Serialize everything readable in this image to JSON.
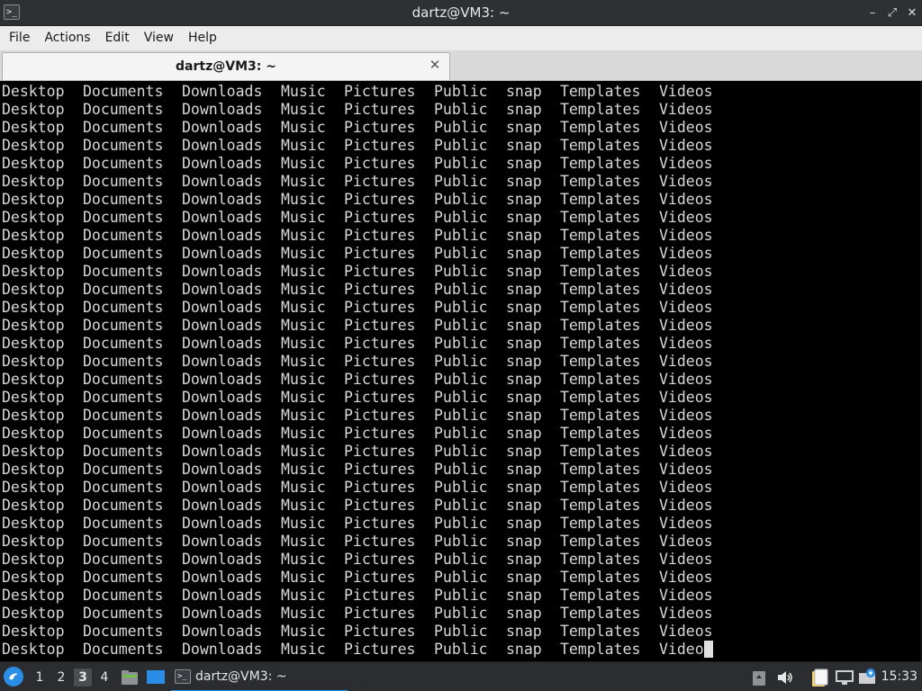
{
  "window": {
    "title": "dartz@VM3: ~",
    "app_icon_glyph": ">_",
    "controls": {
      "minimize": "–",
      "maximize": "⤢",
      "close": "✕"
    }
  },
  "menu": [
    "File",
    "Actions",
    "Edit",
    "View",
    "Help"
  ],
  "tabs": [
    {
      "label": "dartz@VM3: ~",
      "close_glyph": "✕"
    }
  ],
  "terminal": {
    "columns": [
      "Desktop",
      "Documents",
      "Downloads",
      "Music",
      "Pictures",
      "Public",
      "snap",
      "Templates",
      "Videos"
    ],
    "last_line_columns": [
      "Desktop",
      "Documents",
      "Downloads",
      "Music",
      "Pictures",
      "Public",
      "snap",
      "Templates",
      "Video"
    ],
    "repeated_line_count": 31,
    "foreground": "#d8d8d8",
    "background": "#000000"
  },
  "taskbar": {
    "workspaces": [
      "1",
      "2",
      "3",
      "4"
    ],
    "active_workspace": "3",
    "task_label": "dartz@VM3: ~",
    "clock": "15:33",
    "accent": "#2a8de6",
    "tray_icons": [
      "clipboard-icon",
      "volume-icon",
      "files-icon",
      "network-icon",
      "bluetooth-icon"
    ]
  }
}
